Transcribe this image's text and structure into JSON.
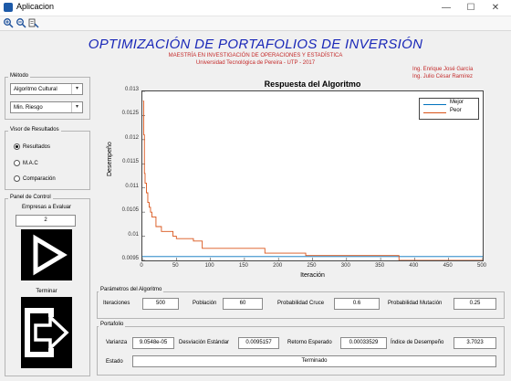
{
  "window": {
    "title": "Aplicacion",
    "minimize": "—",
    "maximize": "☐",
    "close": "✕"
  },
  "toolbar": {
    "zoom_in": "+",
    "zoom_out": "−",
    "data_cursor": "⌖"
  },
  "header": {
    "title": "OPTIMIZACIÓN DE PORTAFOLIOS DE INVERSIÓN",
    "subtitle1": "MAESTRÍA EN INVESTIGACIÓN DE OPERACIONES Y ESTADÍSTICA",
    "subtitle2": "Universidad Tecnológica de Pereira - UTP - 2017",
    "author1": "Ing. Enrique José García",
    "author2": "Ing. Julio César Ramírez"
  },
  "method": {
    "label": "Método",
    "algorithm": "Algoritmo Cultural",
    "objective": "Min. Riesgo"
  },
  "results_viewer": {
    "label": "Visor de Resultados",
    "options": [
      "Resultados",
      "M.A.C",
      "Comparación"
    ],
    "selected_index": 0
  },
  "control": {
    "label": "Panel de Control",
    "companies_label": "Empresas a Evaluar",
    "companies_value": "2",
    "finish_label": "Terminar"
  },
  "chart_data": {
    "type": "line",
    "title": "Respuesta del Algoritmo",
    "xlabel": "Iteración",
    "ylabel": "Desempeño",
    "xlim": [
      0,
      500
    ],
    "ylim": [
      0.0095,
      0.013
    ],
    "xticks": [
      0,
      50,
      100,
      150,
      200,
      250,
      300,
      350,
      400,
      450,
      500
    ],
    "yticks": [
      0.0095,
      0.01,
      0.0105,
      0.011,
      0.0115,
      0.012,
      0.0125,
      0.013
    ],
    "ytick_labels": [
      "0.0095",
      "0.01",
      "0.0105",
      "0.011",
      "0.0115",
      "0.012",
      "0.0125",
      "0.013"
    ],
    "legend_position": "top-right",
    "series": [
      {
        "name": "Mejor",
        "color": "#0072bd",
        "x": [
          0,
          500
        ],
        "y": [
          0.00958,
          0.00958
        ]
      },
      {
        "name": "Peor",
        "color": "#d95319",
        "x": [
          1,
          2,
          2,
          3,
          3,
          4,
          4,
          6,
          6,
          8,
          8,
          10,
          10,
          12,
          12,
          14,
          14,
          20,
          20,
          28,
          28,
          45,
          45,
          50,
          50,
          75,
          75,
          88,
          88,
          180,
          180,
          240,
          240,
          377,
          377,
          500
        ],
        "y": [
          0.0128,
          0.0128,
          0.0121,
          0.0121,
          0.0113,
          0.0113,
          0.0111,
          0.0111,
          0.0109,
          0.0109,
          0.0107,
          0.0107,
          0.0106,
          0.0106,
          0.0105,
          0.0105,
          0.0104,
          0.0104,
          0.0102,
          0.0102,
          0.0101,
          0.0101,
          0.01,
          0.01,
          0.00995,
          0.00995,
          0.0099,
          0.0099,
          0.00975,
          0.00975,
          0.00965,
          0.00965,
          0.0096,
          0.0096,
          0.0095,
          0.0095
        ]
      }
    ]
  },
  "params": {
    "label": "Parámetros del Algoritmo",
    "iter_label": "Iteraciones",
    "iter_value": "500",
    "pop_label": "Población",
    "pop_value": "60",
    "cross_label": "Probabilidad Cruce",
    "cross_value": "0.6",
    "mut_label": "Probabilidad Mutación",
    "mut_value": "0.25"
  },
  "portfolio": {
    "label": "Portafolio",
    "var_label": "Varianza",
    "var_value": "9.0548e-05",
    "std_label": "Desviación Estándar",
    "std_value": "0.0095157",
    "ret_label": "Retorno Esperado",
    "ret_value": "0.00033529",
    "perf_label": "Índice de Desempeño",
    "perf_value": "3.7023",
    "state_label": "Estado",
    "state_value": "Terminado"
  }
}
